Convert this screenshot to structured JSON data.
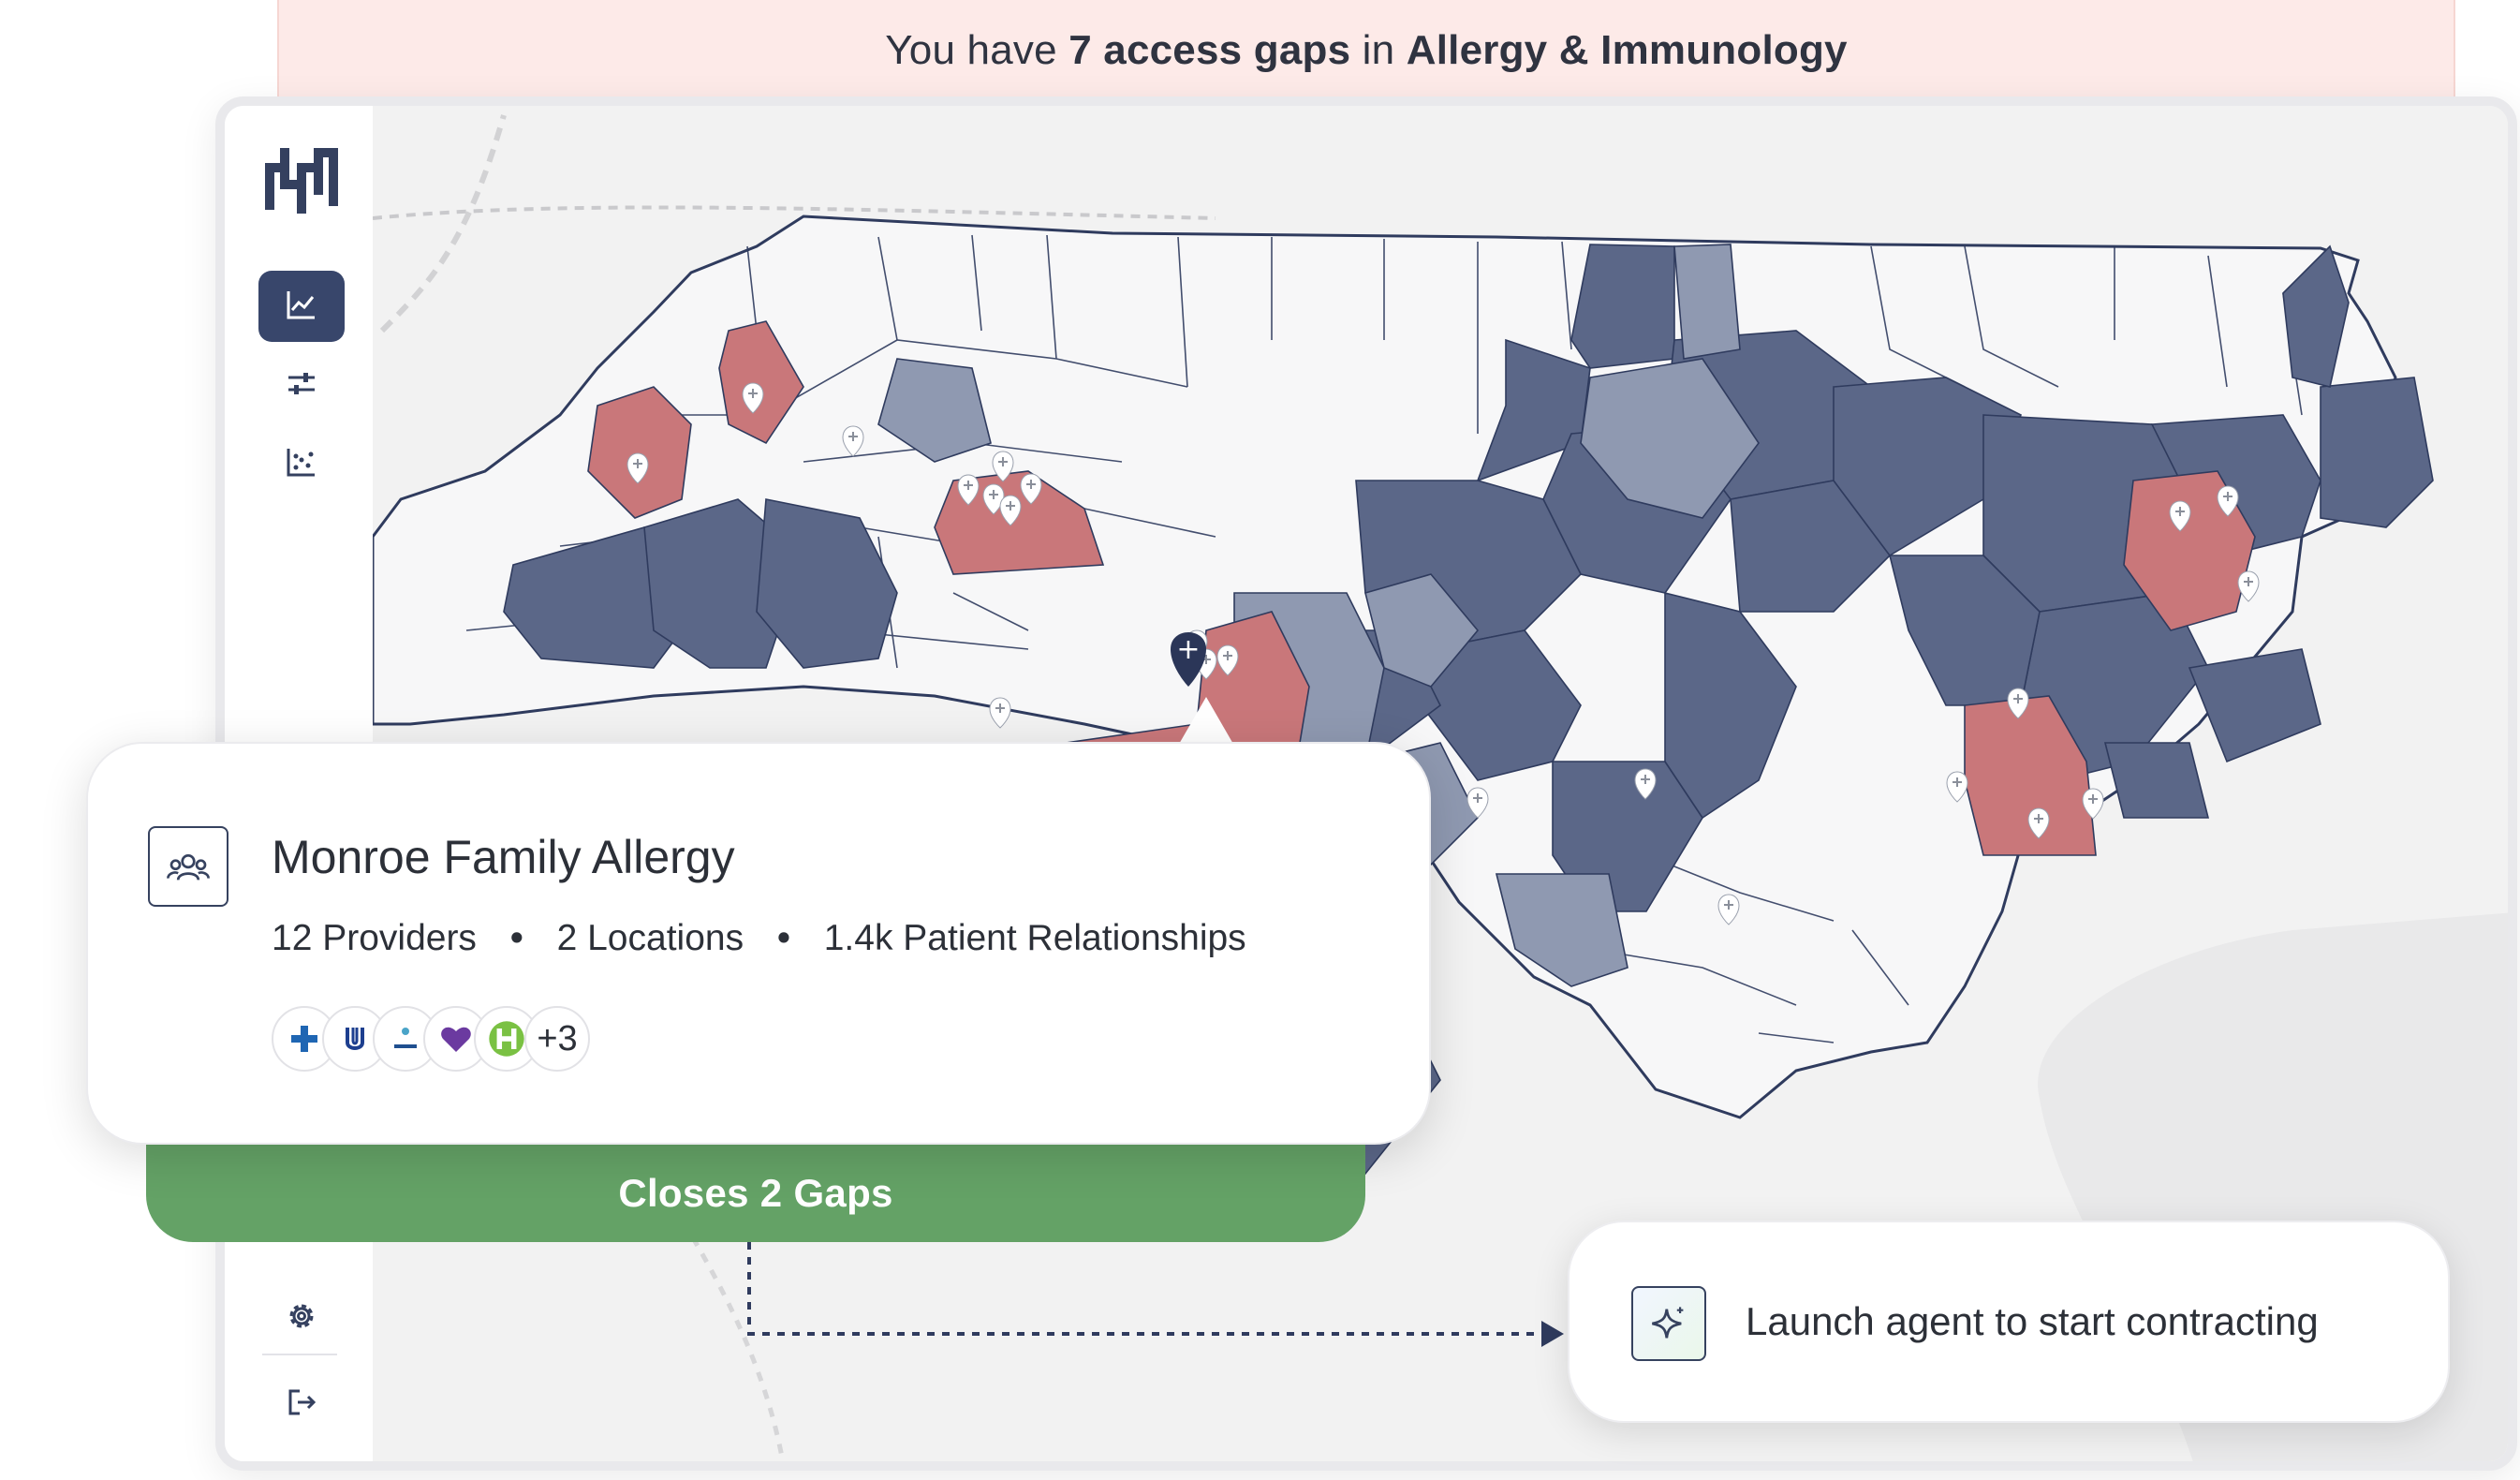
{
  "banner": {
    "prefix": "You have ",
    "gaps": "7 access gaps",
    "middle": " in ",
    "specialty": "Allergy & Immunology"
  },
  "sidebar": {
    "items": [
      {
        "icon": "chart-line-icon",
        "active": true
      },
      {
        "icon": "sliders-icon",
        "active": false
      },
      {
        "icon": "scatter-plot-icon",
        "active": false
      }
    ],
    "bottom": [
      {
        "icon": "gear-icon"
      },
      {
        "icon": "logout-icon"
      }
    ]
  },
  "map": {
    "legend": [],
    "colors": {
      "gap": "#c9777a",
      "covered_dark": "#5b6788",
      "covered_light": "#8f99b1",
      "empty": "#f7f7f8",
      "border": "#2f3b5e"
    }
  },
  "practice_card": {
    "title": "Monroe Family Allergy",
    "stats": [
      "12 Providers",
      "2 Locations",
      "1.4k Patient Relationships"
    ],
    "separator": "•",
    "payers": [
      "blue-cross-icon",
      "united-health-icon",
      "cigna-icon",
      "heart-payer-icon",
      "humana-h-icon"
    ],
    "payers_more": "+3",
    "cta": "Closes 2 Gaps"
  },
  "agent_card": {
    "label": "Launch agent to start contracting",
    "icon": "sparkle-icon"
  }
}
